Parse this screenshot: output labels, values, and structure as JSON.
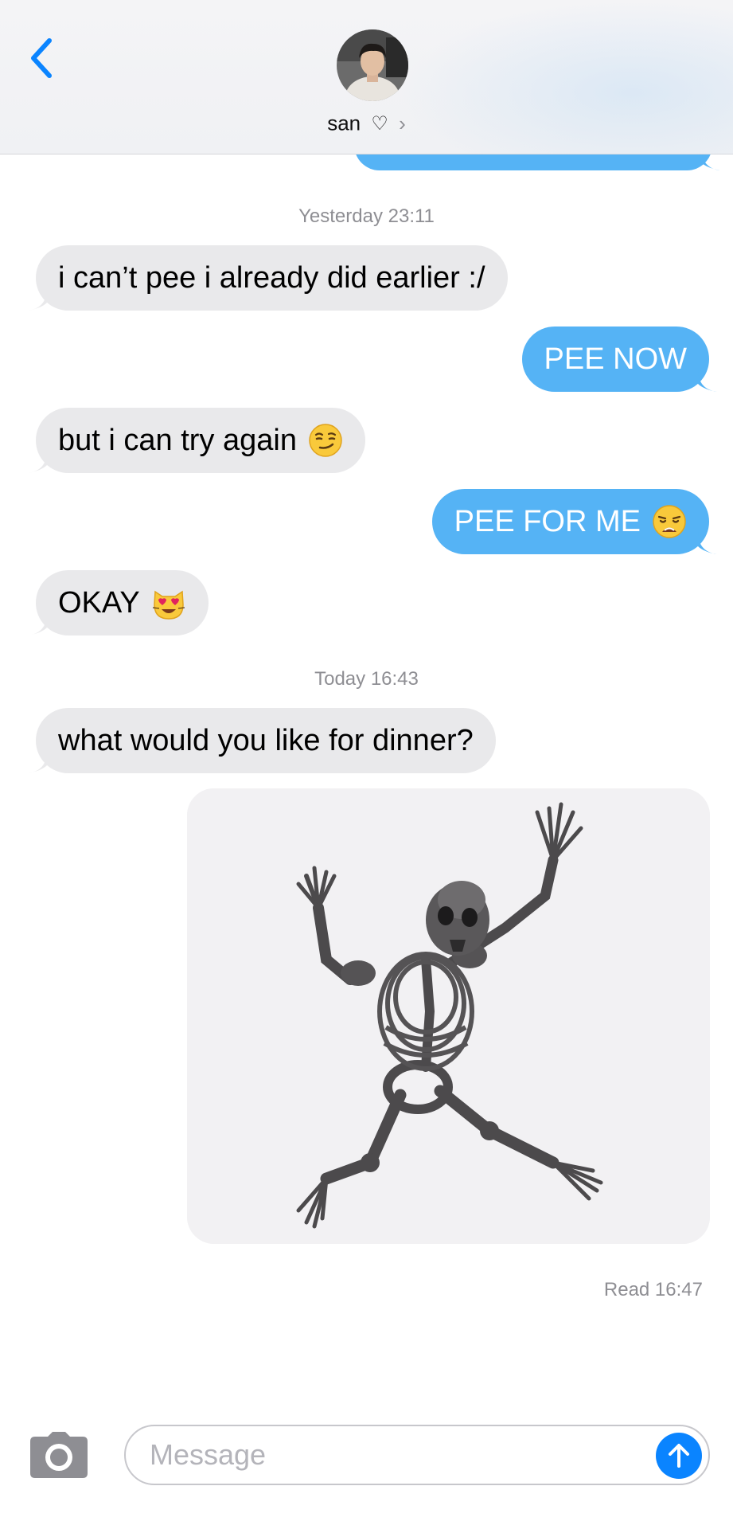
{
  "header": {
    "contact_name": "san",
    "contact_heart": "♡",
    "contact_chevron": "›",
    "back_icon": "chevron-left-icon",
    "accent_color": "#0a84ff"
  },
  "timestamps": {
    "first": "Yesterday 23:11",
    "second": "Today 16:43"
  },
  "messages": [
    {
      "direction": "incoming",
      "text": "i can’t pee i already did earlier :/"
    },
    {
      "direction": "outgoing",
      "text": "PEE NOW"
    },
    {
      "direction": "incoming",
      "text": "but i can try again",
      "emoji": "smirking-face"
    },
    {
      "direction": "outgoing",
      "text": "PEE FOR ME",
      "emoji": "weary-face"
    },
    {
      "direction": "incoming",
      "text": "OKAY",
      "emoji": "heart-eyes-cat"
    },
    {
      "direction": "incoming",
      "text": "what would you like for dinner?"
    },
    {
      "direction": "outgoing",
      "image": "dancing-skeleton"
    }
  ],
  "read_receipt": "Read 16:47",
  "composer": {
    "placeholder": "Message",
    "value": "",
    "camera_icon": "camera-icon",
    "send_icon": "arrow-up-icon"
  },
  "colors": {
    "incoming_bubble": "#e9e9eb",
    "outgoing_bubble": "#55b3f5",
    "timestamp_text": "#8e8e93"
  }
}
